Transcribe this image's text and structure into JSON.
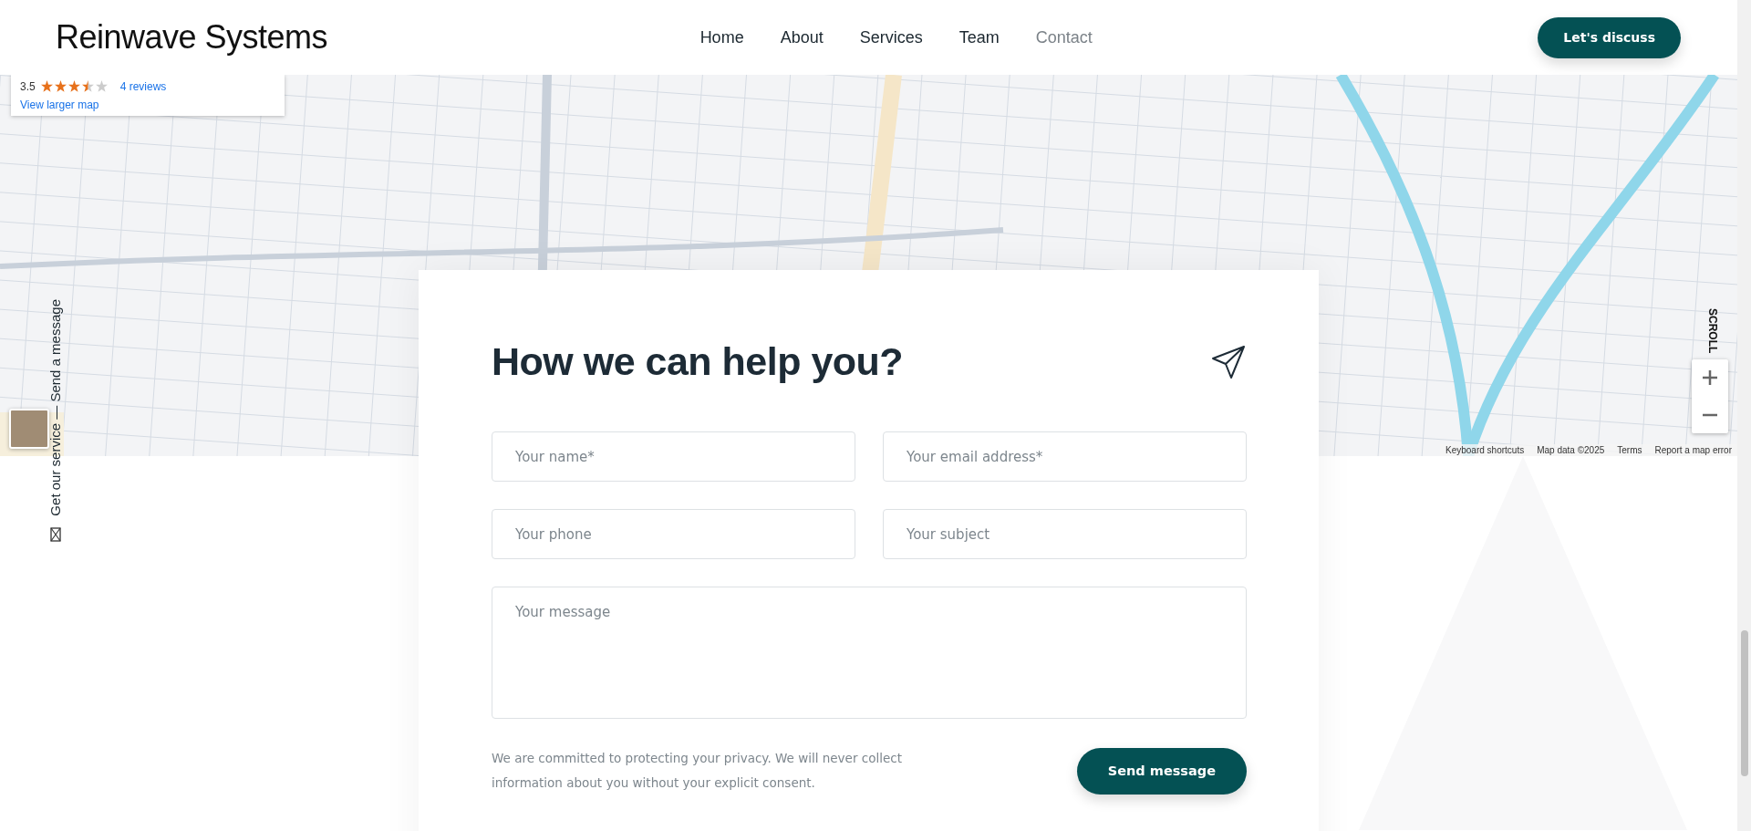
{
  "header": {
    "logo": "Reinwave Systems",
    "nav": [
      {
        "label": "Home",
        "selected": false
      },
      {
        "label": "About",
        "selected": false
      },
      {
        "label": "Services",
        "selected": false
      },
      {
        "label": "Team",
        "selected": false
      },
      {
        "label": "Contact",
        "selected": true
      }
    ],
    "cta": "Let's discuss"
  },
  "map": {
    "kind": "picture",
    "place_card": {
      "rating": "3.5",
      "stars": 3.5,
      "reviews": "4 reviews",
      "link": "View larger map"
    },
    "footer_links": [
      "Keyboard shortcuts",
      "Map data ©2025",
      "Terms",
      "Report a map error"
    ]
  },
  "side_label": "Get our service — Send a message",
  "scroll_label": "SCROLL",
  "form": {
    "title": "How we can help you?",
    "fields": [
      {
        "placeholder": "Your name*",
        "kind": "input"
      },
      {
        "placeholder": "Your email address*",
        "kind": "input"
      },
      {
        "placeholder": "Your phone",
        "kind": "input"
      },
      {
        "placeholder": "Your subject",
        "kind": "input"
      },
      {
        "placeholder": "Your message",
        "kind": "textarea"
      }
    ],
    "privacy": "We are committed to protecting your privacy. We will never collect information about you without your explicit consent.",
    "submit": "Send message"
  }
}
